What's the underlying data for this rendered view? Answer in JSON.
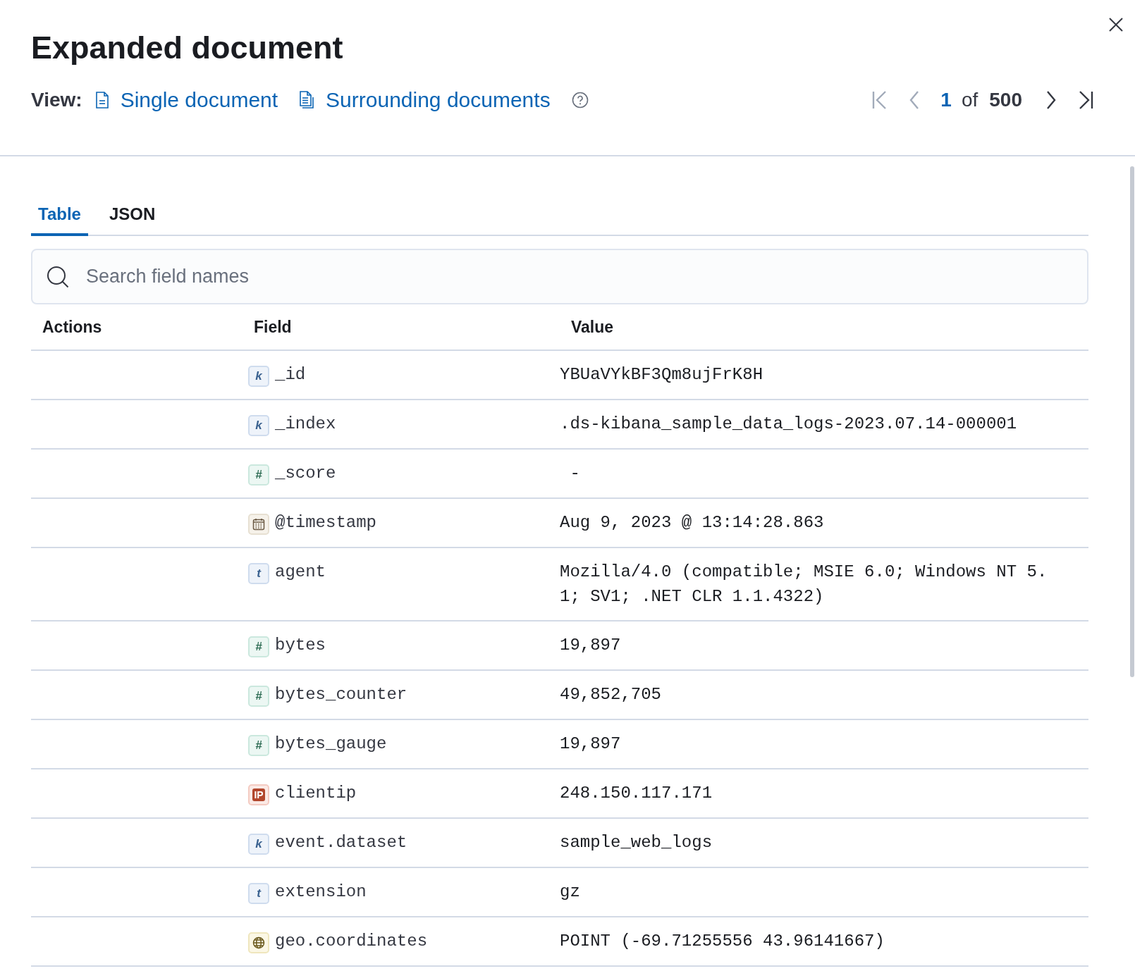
{
  "flyout": {
    "title": "Expanded document",
    "view_label": "View:",
    "view_options": [
      {
        "kind": "single",
        "label": "Single document"
      },
      {
        "kind": "surrounding",
        "label": "Surrounding documents"
      }
    ],
    "pagination": {
      "current": "1",
      "of": "of",
      "total": "500"
    }
  },
  "tabs": [
    {
      "label": "Table",
      "selected": true
    },
    {
      "label": "JSON",
      "selected": false
    }
  ],
  "search": {
    "placeholder": "Search field names"
  },
  "table": {
    "columns": [
      "Actions",
      "Field",
      "Value"
    ],
    "rows": [
      {
        "kind": "keyword",
        "badge": "k",
        "field": "_id",
        "value": "YBUaVYkBF3Qm8ujFrK8H"
      },
      {
        "kind": "keyword",
        "badge": "k",
        "field": "_index",
        "value": ".ds-kibana_sample_data_logs-2023.07.14-000001"
      },
      {
        "kind": "number",
        "badge": "#",
        "field": "_score",
        "value": " -"
      },
      {
        "kind": "date",
        "field": "@timestamp",
        "value": "Aug 9, 2023 @ 13:14:28.863"
      },
      {
        "kind": "text",
        "badge": "t",
        "field": "agent",
        "value": "Mozilla/4.0 (compatible; MSIE 6.0; Windows NT 5.1; SV1; .NET CLR 1.1.4322)"
      },
      {
        "kind": "number",
        "badge": "#",
        "field": "bytes",
        "value": "19,897"
      },
      {
        "kind": "number",
        "badge": "#",
        "field": "bytes_counter",
        "value": "49,852,705"
      },
      {
        "kind": "number",
        "badge": "#",
        "field": "bytes_gauge",
        "value": "19,897"
      },
      {
        "kind": "ip",
        "badge": "IP",
        "field": "clientip",
        "value": "248.150.117.171"
      },
      {
        "kind": "keyword",
        "badge": "k",
        "field": "event.dataset",
        "value": "sample_web_logs"
      },
      {
        "kind": "text",
        "badge": "t",
        "field": "extension",
        "value": "gz"
      },
      {
        "kind": "geo",
        "field": "geo.coordinates",
        "value": "POINT (-69.71255556 43.96141667)"
      }
    ]
  }
}
